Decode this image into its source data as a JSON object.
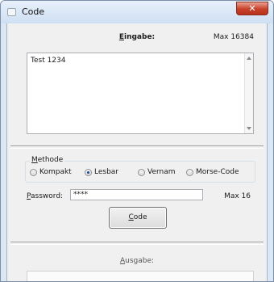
{
  "window": {
    "title": "Code",
    "close_glyph": "✕"
  },
  "input": {
    "label_hotkey": "E",
    "label_rest": "ingabe:",
    "max_label": "Max 16384",
    "text": "Test 1234"
  },
  "method": {
    "group_hotkey": "M",
    "group_rest": "ethode",
    "options": [
      {
        "label": "Kompakt",
        "checked": false
      },
      {
        "label": "Lesbar",
        "checked": true
      },
      {
        "label": "Vernam",
        "checked": false
      },
      {
        "label": "Morse-Code",
        "checked": false
      }
    ]
  },
  "password": {
    "label_hotkey": "P",
    "label_rest": "assword:",
    "value": "****",
    "max_label": "Max 16"
  },
  "code_button": {
    "hotkey": "C",
    "rest": "ode"
  },
  "output": {
    "label_hotkey": "A",
    "label_rest": "usgabe:",
    "value": ""
  },
  "icons": {
    "close": "close-icon",
    "app": "window-app-icon"
  }
}
